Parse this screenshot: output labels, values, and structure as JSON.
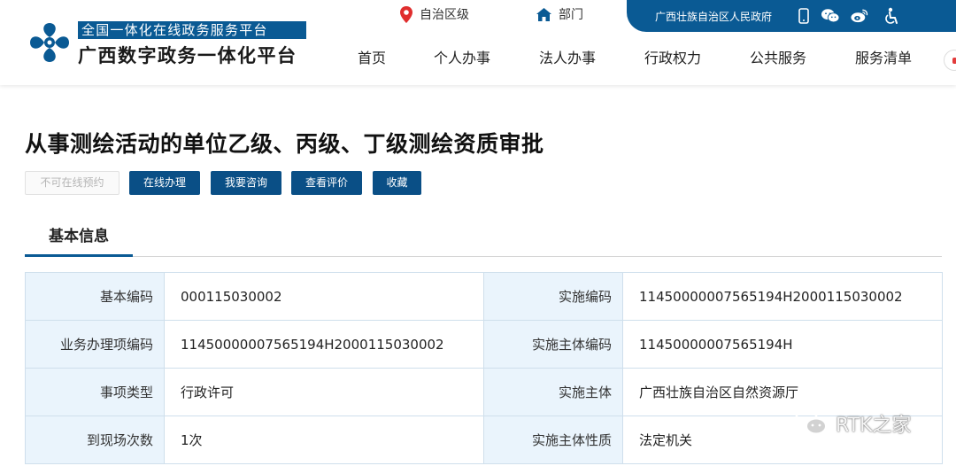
{
  "brand": {
    "top_line": "全国一体化在线政务服务平台",
    "main_line": "广西数字政务一体化平台",
    "colors": {
      "primary": "#0a5a94",
      "button": "#0a4f86",
      "label_bg": "#eaf4fc",
      "pin": "#e02e2e"
    }
  },
  "location": {
    "region": {
      "icon": "map-pin-icon",
      "label": "自治区级"
    },
    "department": {
      "icon": "home-icon",
      "label": "部门"
    }
  },
  "topbar": {
    "title": "广西壮族自治区人民政府",
    "icons": [
      "mobile-icon",
      "wechat-icon",
      "weibo-icon",
      "accessibility-icon"
    ]
  },
  "nav": {
    "items": [
      {
        "label": "首页"
      },
      {
        "label": "个人办事"
      },
      {
        "label": "法人办事"
      },
      {
        "label": "行政权力"
      },
      {
        "label": "公共服务"
      },
      {
        "label": "服务清单"
      }
    ]
  },
  "page": {
    "title": "从事测绘活动的单位乙级、丙级、丁级测绘资质审批"
  },
  "actions": {
    "disabled_label": "不可在线预约",
    "buttons": [
      {
        "label": "在线办理"
      },
      {
        "label": "我要咨询"
      },
      {
        "label": "查看评价"
      },
      {
        "label": "收藏"
      }
    ]
  },
  "tabs": {
    "active": "基本信息"
  },
  "info": {
    "rows": [
      {
        "label1": "基本编码",
        "value1": "000115030002",
        "label2": "实施编码",
        "value2": "11450000007565194H2000115030002"
      },
      {
        "label1": "业务办理项编码",
        "value1": "11450000007565194H2000115030002",
        "label2": "实施主体编码",
        "value2": "11450000007565194H"
      },
      {
        "label1": "事项类型",
        "value1": "行政许可",
        "label2": "实施主体",
        "value2": "广西壮族自治区自然资源厅"
      },
      {
        "label1": "到现场次数",
        "value1": "1次",
        "label2": "实施主体性质",
        "value2": "法定机关"
      }
    ]
  },
  "watermark": {
    "icon": "wechat-icon",
    "text": "RTK之家"
  }
}
